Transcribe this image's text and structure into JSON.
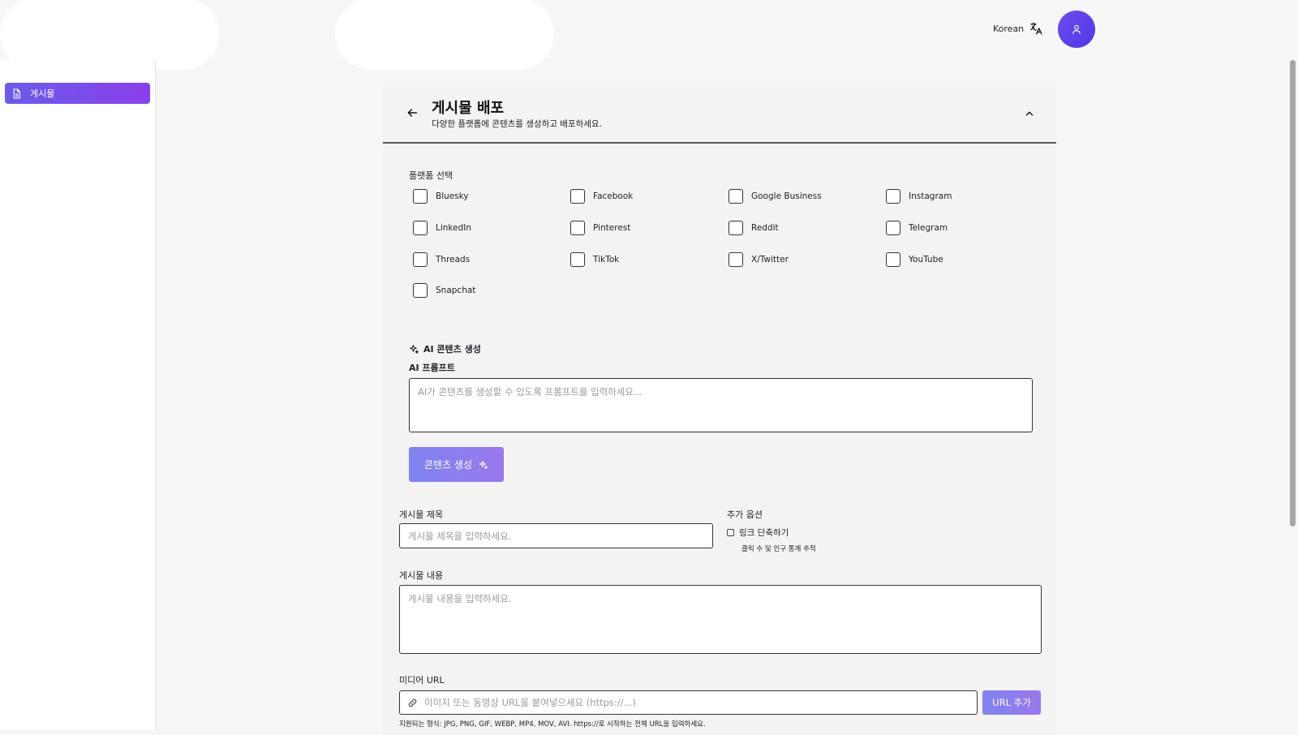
{
  "header": {
    "language_label": "Korean",
    "language_icon": "translate-icon",
    "avatar_icon": "user-icon",
    "accent": "#5b3fe9"
  },
  "sidebar": {
    "items": [
      {
        "label": "게시물",
        "icon": "document-icon",
        "active": true
      }
    ]
  },
  "panel": {
    "title": "게시물 배포",
    "subtitle": "다양한 플랫폼에 콘텐츠를 생성하고 배포하세요.",
    "platform_label": "플랫폼 선택",
    "platforms": [
      "Bluesky",
      "Facebook",
      "Google Business",
      "Instagram",
      "LinkedIn",
      "Pinterest",
      "Reddit",
      "Telegram",
      "Threads",
      "TikTok",
      "X/Twitter",
      "YouTube",
      "Snapchat"
    ],
    "ai": {
      "section_title": "AI 콘텐츠 생성",
      "prompt_label": "AI 프롬프트",
      "prompt_placeholder": "AI가 콘텐츠를 생성할 수 있도록 프롬프트를 입력하세요...",
      "generate_button": "콘텐츠 생성"
    },
    "post_title": {
      "label": "게시물 제목",
      "placeholder": "게시물 제목을 입력하세요."
    },
    "extra_options": {
      "label": "추가 옵션",
      "shorten_label": "링크 단축하기",
      "shorten_hint": "클릭 수 및 인구 통계 추적"
    },
    "post_content": {
      "label": "게시물 내용",
      "placeholder": "게시물 내용을 입력하세요."
    },
    "media": {
      "label": "미디어 URL",
      "placeholder": "이미지 또는 동영상 URL을 붙여넣으세요 (https://...)",
      "add_button": "URL 추가",
      "hint": "지원되는 형식: JPG, PNG, GIF, WEBP, MP4, MOV, AVI. https://로 시작하는 전체 URL을 입력하세요."
    }
  }
}
